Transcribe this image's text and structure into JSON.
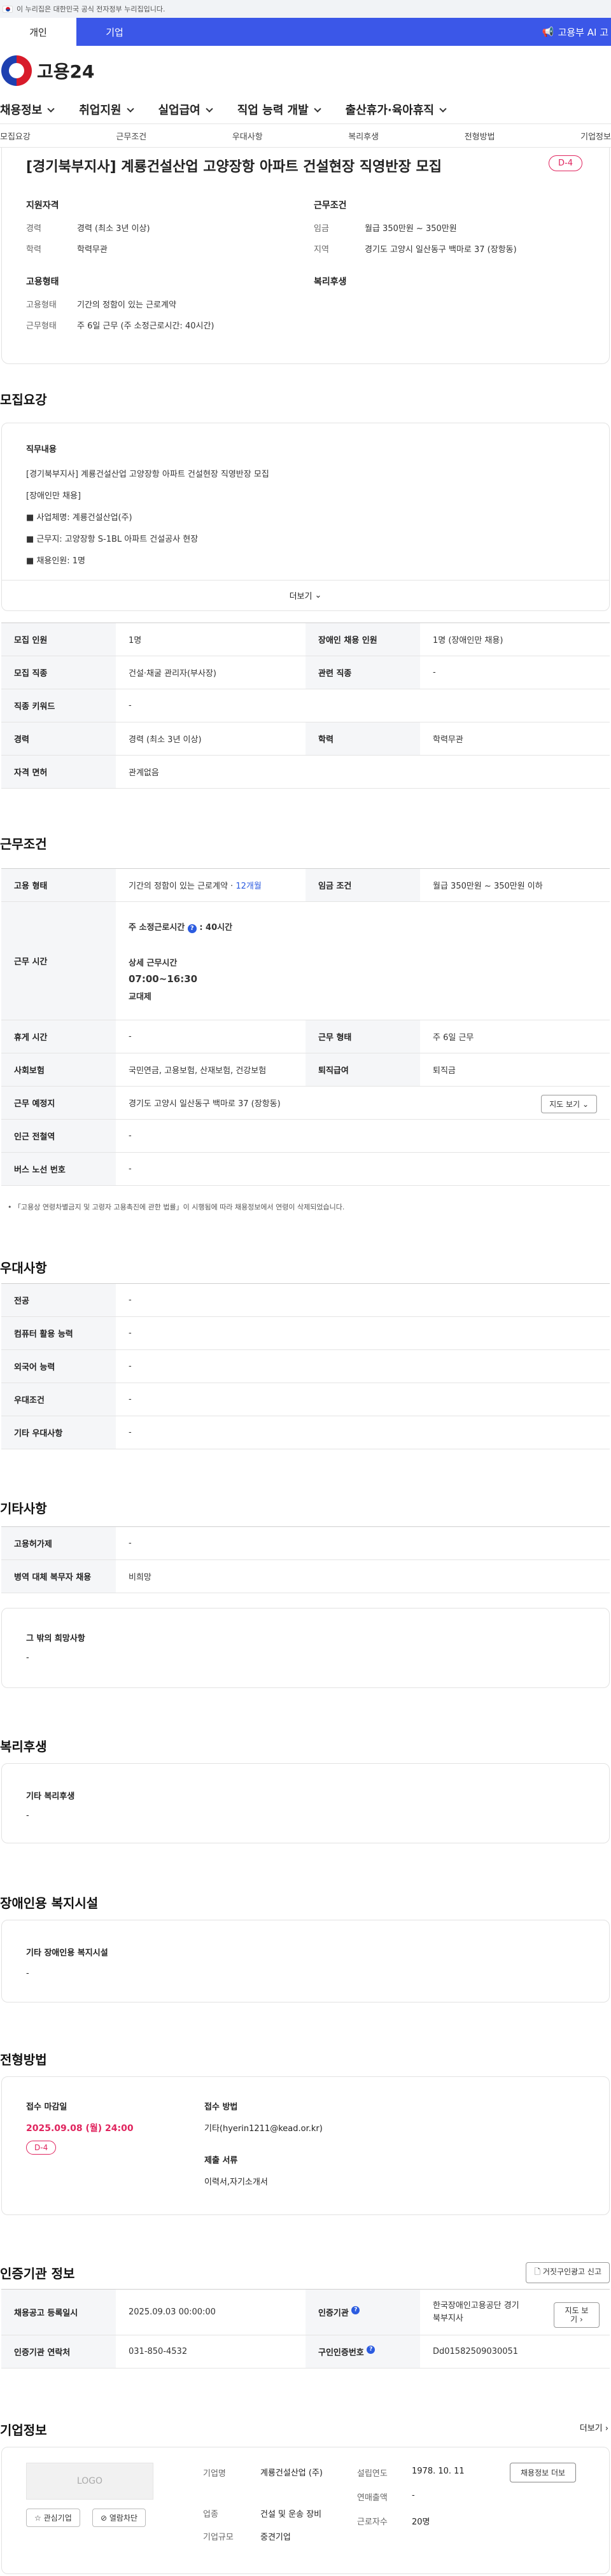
{
  "gov_bar": {
    "text": "이 누리집은 대한민국 공식 전자정부 누리집입니다."
  },
  "user_tabs": [
    {
      "label": "개인",
      "active": true
    },
    {
      "label": "기업",
      "active": false
    }
  ],
  "banner": {
    "text": "고용부 AI 고"
  },
  "logo": {
    "text": "고용24"
  },
  "gnb": [
    "채용정보",
    "취업지원",
    "실업급여",
    "직업 능력 개발",
    "출산휴가·육아휴직"
  ],
  "anchor_tabs": [
    "모집요강",
    "근무조건",
    "우대사항",
    "복리후생",
    "전형방법",
    "기업정보"
  ],
  "title_card": {
    "title": "[경기북부지사] 계룡건설산업 고양장항 아파트 건설현장 직영반장 모집",
    "dday": "D-4",
    "qual": {
      "head": "지원자격",
      "rows": [
        [
          "경력",
          "경력 (최소 3년 이상)"
        ],
        [
          "학력",
          "학력무관"
        ]
      ]
    },
    "work": {
      "head": "근무조건",
      "rows": [
        [
          "임금",
          "월급 350만원 ~ 350만원"
        ],
        [
          "지역",
          "경기도 고양시 일산동구 백마로 37 (장항동)"
        ]
      ]
    },
    "emp": {
      "head": "고용형태",
      "rows": [
        [
          "고용형태",
          "기간의 정함이 있는 근로계약"
        ],
        [
          "근무형태",
          "주 6일 근무 (주 소정근로시간: 40시간)"
        ]
      ]
    },
    "welfare": {
      "head": "복리후생"
    }
  },
  "recruit": {
    "title": "모집요강",
    "desc_head": "직무내용",
    "desc_lines": [
      "[경기북부지사] 계룡건설산업 고양장항 아파트 건설현장 직영반장 모집",
      "[장애인만 채용]",
      "■ 사업체명: 계룡건설산업(주)",
      "■ 근무지: 고양장항 S-1BL 아파트 건설공사 현장",
      "■ 채용인원: 1명"
    ],
    "more": "더보기",
    "rows": [
      [
        "모집 인원",
        "1명",
        "장애인 채용 인원",
        "1명 (장애인만 채용)"
      ],
      [
        "모집 직종",
        "건설·채굴 관리자(부사장)",
        "관련 직종",
        "-"
      ],
      [
        "직종 키워드",
        "-"
      ],
      [
        "경력",
        "경력 (최소 3년 이상)",
        "학력",
        "학력무관"
      ],
      [
        "자격 면허",
        "관계없음"
      ]
    ]
  },
  "conditions": {
    "title": "근무조건",
    "emp_type_k": "고용 형태",
    "emp_type_v": "기간의 정함이 있는 근로계약 · ",
    "emp_type_months": "12개월",
    "wage_k": "임금 조건",
    "wage_v": "월급 350만원 ~ 350만원 이하",
    "hours_k": "근무 시간",
    "hours_l1": "주 소정근로시간",
    "hours_l1v": ": 40시간",
    "hours_l2": "상세 근무시간",
    "hours_l3": "07:00~16:30",
    "hours_l4": "교대제",
    "rows2": [
      [
        "휴게 시간",
        "-",
        "근무 형태",
        "주 6일 근무"
      ],
      [
        "사회보험",
        "국민연금, 고용보험, 산재보험, 건강보험",
        "퇴직급여",
        "퇴직금"
      ]
    ],
    "place_k": "근무 예정지",
    "place_v": "경기도 고양시 일산동구 백마로 37 (장항동)",
    "map_btn": "지도 보기",
    "station_k": "인근 전철역",
    "station_v": "-",
    "bus_k": "버스 노선 번호",
    "bus_v": "-",
    "note": "「고용상 연령차별금지 및 고령자 고용촉진에 관한 법률」이 시행됨에 따라 채용정보에서 연령이 삭제되었습니다."
  },
  "preference": {
    "title": "우대사항",
    "rows": [
      [
        "전공",
        "-"
      ],
      [
        "컴퓨터 활용 능력",
        "-"
      ],
      [
        "외국어 능력",
        "-"
      ],
      [
        "우대조건",
        "-"
      ],
      [
        "기타 우대사항",
        "-"
      ]
    ]
  },
  "other": {
    "title": "기타사항",
    "rows": [
      [
        "고용허가제",
        "-"
      ],
      [
        "병역 대체 복무자 채용",
        "비희망"
      ]
    ],
    "box_head": "그 밖의 희망사항",
    "box_val": "-"
  },
  "welfare": {
    "title": "복리후생",
    "head": "기타 복리후생",
    "val": "-"
  },
  "disabled": {
    "title": "장애인용 복지시설",
    "head": "기타 장애인용 복지시설",
    "val": "-"
  },
  "process": {
    "title": "전형방법",
    "deadline_head": "접수 마감일",
    "deadline": "2025.09.08 (월) 24:00",
    "dday": "D-4",
    "method_head": "접수 방법",
    "method": "기타(hyerin1211@kead.or.kr)",
    "docs_head": "제출 서류",
    "docs": "이력서,자기소개서"
  },
  "cert": {
    "title": "인증기관 정보",
    "report_btn": "거짓구인광고 신고",
    "r1": [
      "채용공고 등록일시",
      "2025.09.03 00:00:00",
      "인증기관",
      "한국장애인고용공단 경기북부지사",
      "지도 보기"
    ],
    "r2": [
      "인증기관 연락처",
      "031-850-4532",
      "구인인증번호",
      "Dd01582509030051"
    ]
  },
  "company": {
    "title": "기업정보",
    "more": "더보기",
    "logo": "LOGO",
    "interest": "관심기업",
    "block": "열람차단",
    "name_k": "기업명",
    "name_v": "계룡건설산업 (주)",
    "est_k": "설립연도",
    "est_v": "1978. 10. 11",
    "jobs_btn": "채용정보 더보",
    "ind_k": "업종",
    "ind_v": "건설 및 운송 장비",
    "rev_k": "연매출액",
    "rev_v": "-",
    "size_k": "기업규모",
    "size_v": "중견기업",
    "emp_k": "근로자수",
    "emp_v": "20명"
  }
}
